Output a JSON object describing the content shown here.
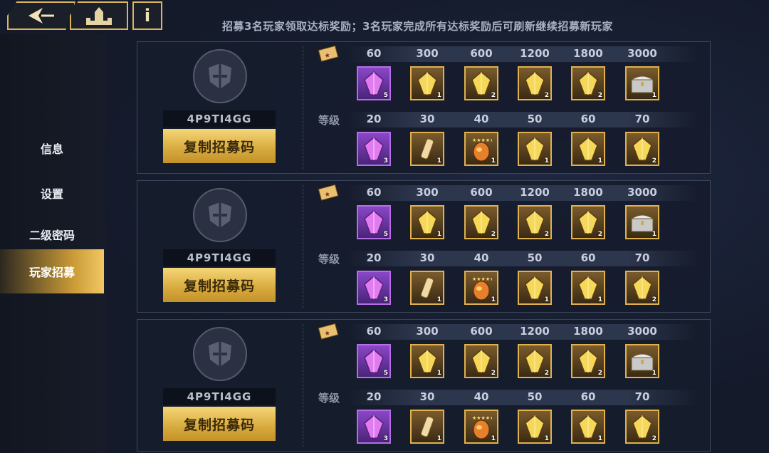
{
  "top": {
    "notice": "招募3名玩家领取达标奖励；3名玩家完成所有达标奖励后可刷新继续招募新玩家",
    "info_label": "i"
  },
  "sidebar": {
    "items": [
      {
        "label": "信息",
        "active": false
      },
      {
        "label": "设置",
        "active": false
      },
      {
        "label": "二级密码",
        "active": false
      },
      {
        "label": "玩家招募",
        "active": true
      }
    ]
  },
  "panels": [
    {
      "code": "4P9TI4GG",
      "copy_label": "复制招募码",
      "row1_thresholds": [
        "60",
        "300",
        "600",
        "1200",
        "1800",
        "3000"
      ],
      "row2_label": "等级",
      "row2_thresholds": [
        "20",
        "30",
        "40",
        "50",
        "60",
        "70"
      ],
      "row1_items": [
        {
          "type": "purple-crystal",
          "count": "5"
        },
        {
          "type": "gold-crystal",
          "count": "1"
        },
        {
          "type": "gold-crystal",
          "count": "2"
        },
        {
          "type": "gold-crystal",
          "count": "2"
        },
        {
          "type": "gold-crystal",
          "count": "2"
        },
        {
          "type": "chest",
          "count": "1"
        }
      ],
      "row2_items": [
        {
          "type": "purple-crystal",
          "count": "3"
        },
        {
          "type": "scroll",
          "count": "1"
        },
        {
          "type": "egg",
          "count": "1"
        },
        {
          "type": "gold-crystal",
          "count": "1"
        },
        {
          "type": "gold-crystal",
          "count": "1"
        },
        {
          "type": "gold-crystal",
          "count": "2"
        }
      ]
    },
    {
      "code": "4P9TI4GG",
      "copy_label": "复制招募码",
      "row1_thresholds": [
        "60",
        "300",
        "600",
        "1200",
        "1800",
        "3000"
      ],
      "row2_label": "等级",
      "row2_thresholds": [
        "20",
        "30",
        "40",
        "50",
        "60",
        "70"
      ],
      "row1_items": [
        {
          "type": "purple-crystal",
          "count": "5"
        },
        {
          "type": "gold-crystal",
          "count": "1"
        },
        {
          "type": "gold-crystal",
          "count": "2"
        },
        {
          "type": "gold-crystal",
          "count": "2"
        },
        {
          "type": "gold-crystal",
          "count": "2"
        },
        {
          "type": "chest",
          "count": "1"
        }
      ],
      "row2_items": [
        {
          "type": "purple-crystal",
          "count": "3"
        },
        {
          "type": "scroll",
          "count": "1"
        },
        {
          "type": "egg",
          "count": "1"
        },
        {
          "type": "gold-crystal",
          "count": "1"
        },
        {
          "type": "gold-crystal",
          "count": "1"
        },
        {
          "type": "gold-crystal",
          "count": "2"
        }
      ]
    },
    {
      "code": "4P9TI4GG",
      "copy_label": "复制招募码",
      "row1_thresholds": [
        "60",
        "300",
        "600",
        "1200",
        "1800",
        "3000"
      ],
      "row2_label": "等级",
      "row2_thresholds": [
        "20",
        "30",
        "40",
        "50",
        "60",
        "70"
      ],
      "row1_items": [
        {
          "type": "purple-crystal",
          "count": "5"
        },
        {
          "type": "gold-crystal",
          "count": "1"
        },
        {
          "type": "gold-crystal",
          "count": "2"
        },
        {
          "type": "gold-crystal",
          "count": "2"
        },
        {
          "type": "gold-crystal",
          "count": "2"
        },
        {
          "type": "chest",
          "count": "1"
        }
      ],
      "row2_items": [
        {
          "type": "purple-crystal",
          "count": "3"
        },
        {
          "type": "scroll",
          "count": "1"
        },
        {
          "type": "egg",
          "count": "1"
        },
        {
          "type": "gold-crystal",
          "count": "1"
        },
        {
          "type": "gold-crystal",
          "count": "1"
        },
        {
          "type": "gold-crystal",
          "count": "2"
        }
      ]
    }
  ],
  "colors": {
    "gold": "#e0b14d",
    "purple": "#b56ee6",
    "background": "#141a2a"
  }
}
